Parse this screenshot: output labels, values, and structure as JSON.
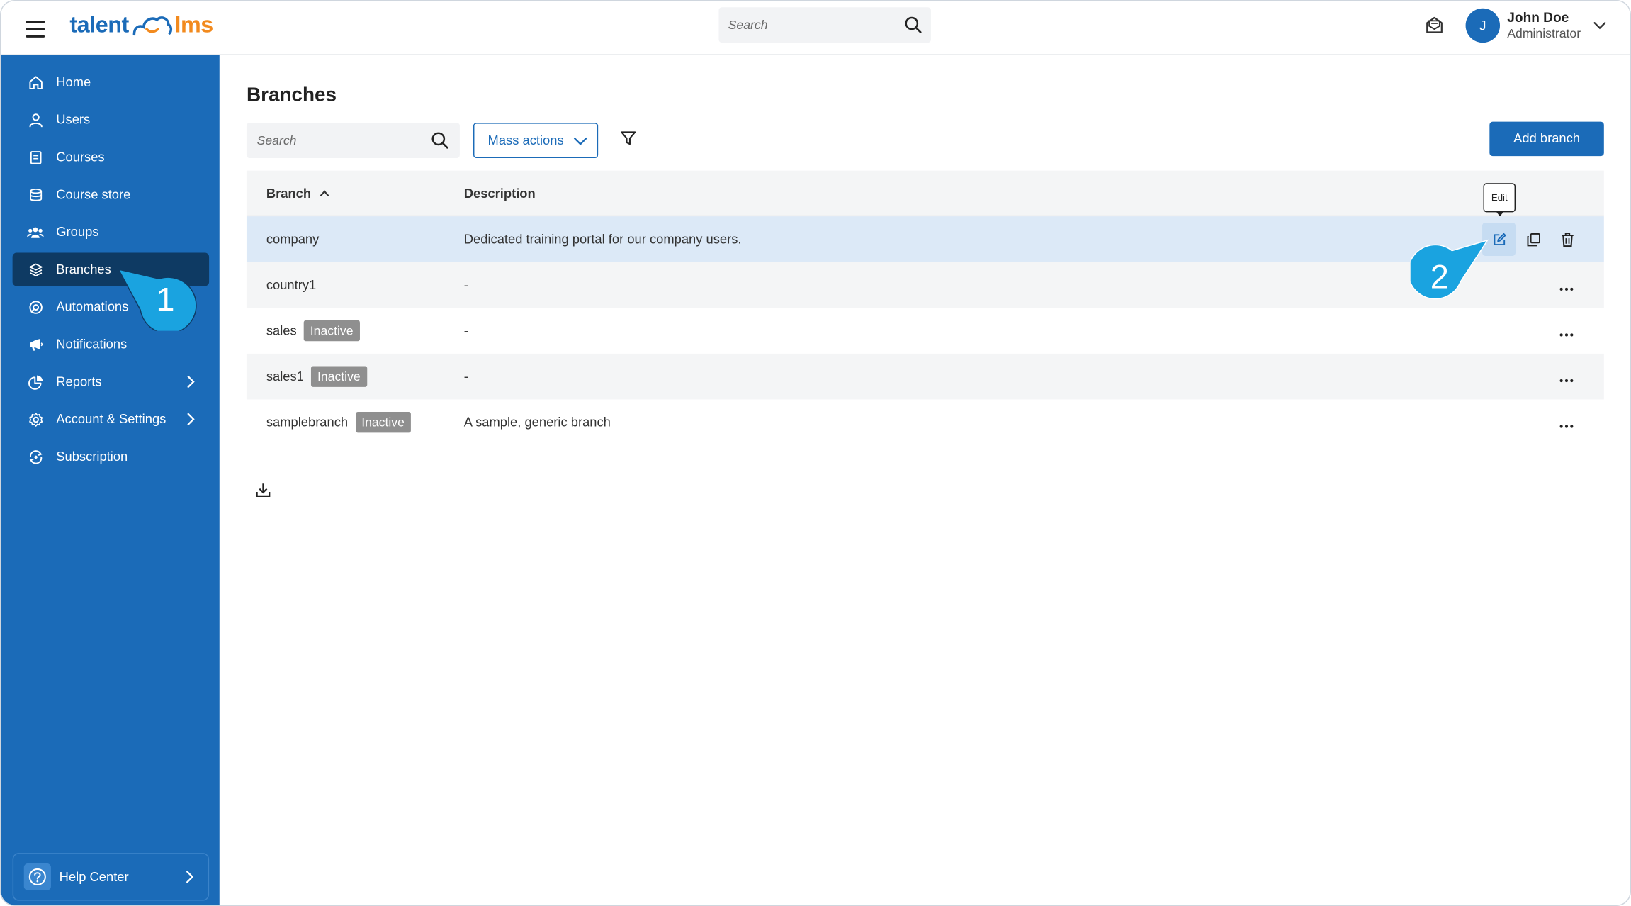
{
  "header": {
    "logo_left": "talent",
    "logo_right": "lms",
    "search_placeholder": "Search",
    "user_initial": "J",
    "user_name": "John Doe",
    "user_role": "Administrator"
  },
  "sidebar": {
    "items": [
      {
        "label": "Home",
        "icon": "home-icon"
      },
      {
        "label": "Users",
        "icon": "user-icon"
      },
      {
        "label": "Courses",
        "icon": "book-icon"
      },
      {
        "label": "Course store",
        "icon": "store-icon"
      },
      {
        "label": "Groups",
        "icon": "group-icon"
      },
      {
        "label": "Branches",
        "icon": "layers-icon",
        "active": true
      },
      {
        "label": "Automations",
        "icon": "automation-icon"
      },
      {
        "label": "Notifications",
        "icon": "megaphone-icon"
      },
      {
        "label": "Reports",
        "icon": "pie-chart-icon",
        "has_submenu": true
      },
      {
        "label": "Account & Settings",
        "icon": "gear-icon",
        "has_submenu": true
      },
      {
        "label": "Subscription",
        "icon": "subscription-icon"
      }
    ],
    "help_label": "Help Center"
  },
  "main": {
    "title": "Branches",
    "search_placeholder": "Search",
    "mass_actions_label": "Mass actions",
    "add_button_label": "Add branch",
    "columns": {
      "branch": "Branch",
      "description": "Description"
    },
    "tooltip": "Edit",
    "rows": [
      {
        "name": "company",
        "status": "",
        "description": "Dedicated training portal for our company users."
      },
      {
        "name": "country1",
        "status": "",
        "description": "-"
      },
      {
        "name": "sales",
        "status": "Inactive",
        "description": "-"
      },
      {
        "name": "sales1",
        "status": "Inactive",
        "description": "-"
      },
      {
        "name": "samplebranch",
        "status": "Inactive",
        "description": "A sample, generic branch"
      }
    ]
  },
  "callouts": {
    "step1": "1",
    "step2": "2"
  },
  "colors": {
    "brand_blue": "#1b6bb8",
    "sidebar_active": "#0e3a63",
    "logo_orange": "#f28a1e",
    "callout_blue": "#1aa3e0"
  }
}
